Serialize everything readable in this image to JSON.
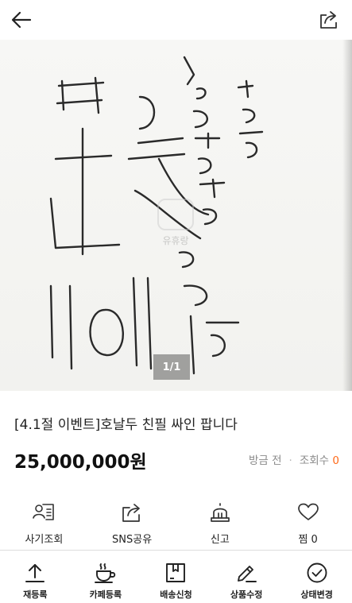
{
  "header": {
    "back_icon": "arrow-left-icon",
    "share_icon": "share-out-icon"
  },
  "photo": {
    "watermark": "유휴랑",
    "counter": "1/1"
  },
  "product": {
    "title": "[4.1절 이벤트]호날두 친필 싸인 팝니다",
    "price": "25,000,000원",
    "time": "방금 전",
    "views_label": "조회수",
    "views_count": "0"
  },
  "actions": [
    {
      "label": "사기조회",
      "icon": "fraud-check-icon"
    },
    {
      "label": "SNS공유",
      "icon": "sns-share-icon"
    },
    {
      "label": "신고",
      "icon": "siren-icon"
    },
    {
      "label": "찜 0",
      "icon": "heart-icon"
    }
  ],
  "bottom_bar": [
    {
      "label": "재등록",
      "icon": "upload-icon"
    },
    {
      "label": "카페등록",
      "icon": "coffee-cup-icon"
    },
    {
      "label": "배송신청",
      "icon": "box-icon"
    },
    {
      "label": "상품수정",
      "icon": "pencil-icon"
    },
    {
      "label": "상태변경",
      "icon": "check-circle-icon"
    }
  ]
}
